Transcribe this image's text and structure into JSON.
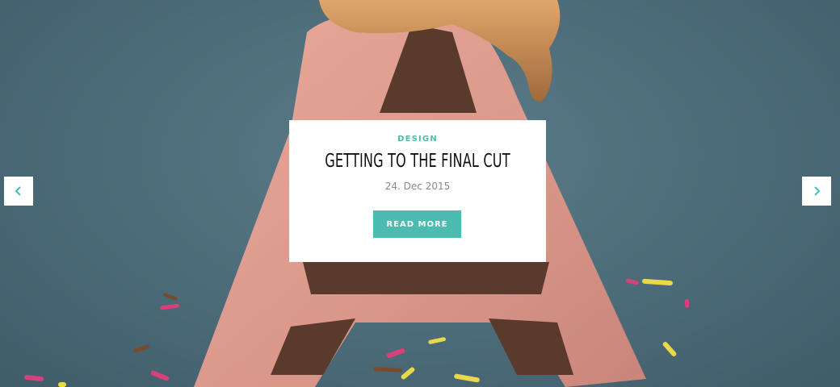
{
  "slide": {
    "category": "DESIGN",
    "title": "GETTING TO THE FINAL CUT",
    "date": "24. Dec 2015",
    "read_more_label": "READ MORE"
  },
  "navigation": {
    "prev_icon": "chevron-left-icon",
    "next_icon": "chevron-right-icon"
  },
  "colors": {
    "accent": "#4cbcb0",
    "background": "#4d6e7c",
    "card": "#ffffff"
  }
}
